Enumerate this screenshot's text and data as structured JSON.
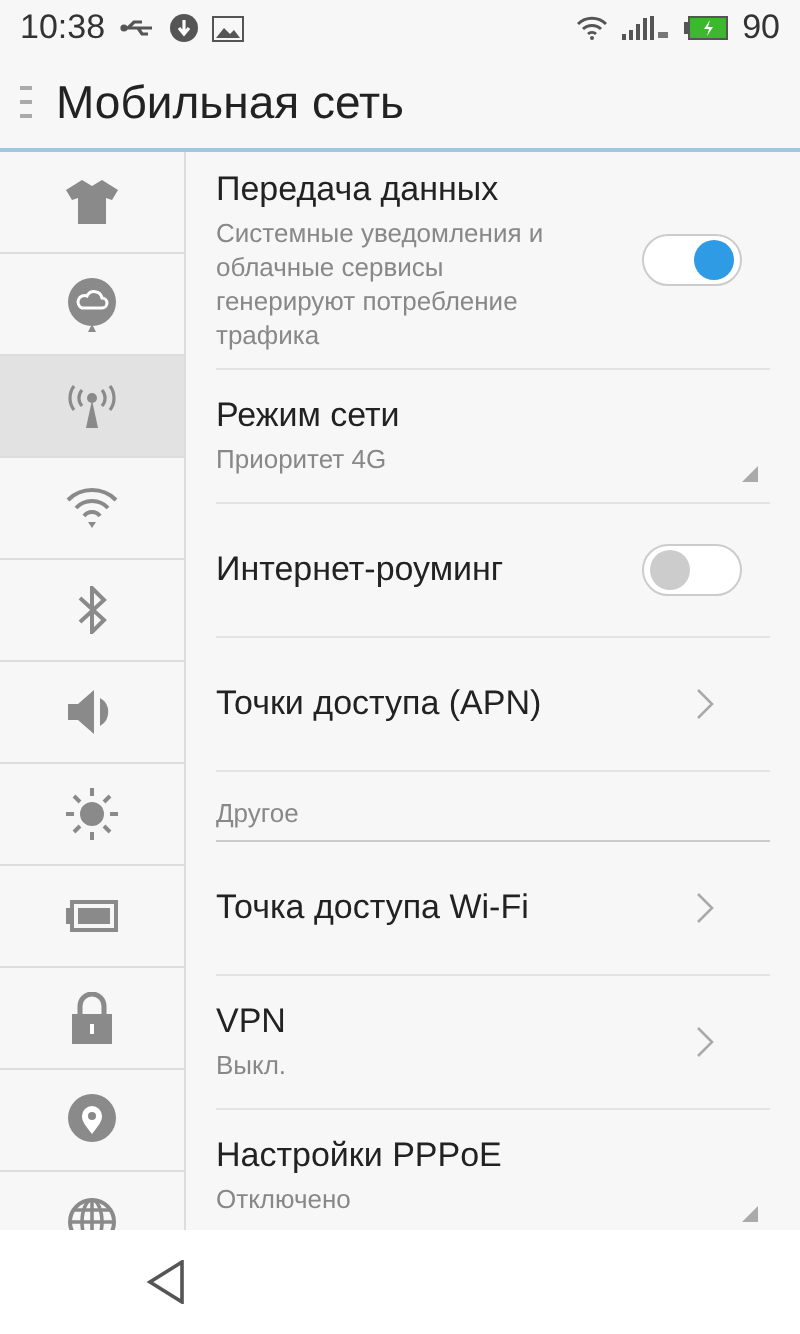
{
  "status_bar": {
    "time": "10:38",
    "battery": "90"
  },
  "title_bar": {
    "title": "Мобильная сеть"
  },
  "sidebar": {
    "items": [
      {
        "selected": false
      },
      {
        "selected": false
      },
      {
        "selected": true
      },
      {
        "selected": false
      },
      {
        "selected": false
      },
      {
        "selected": false
      },
      {
        "selected": false
      },
      {
        "selected": false
      },
      {
        "selected": false
      },
      {
        "selected": false
      },
      {
        "selected": false
      }
    ]
  },
  "settings": [
    {
      "kind": "toggle",
      "title": "Передача данных",
      "subtitle": "Системные уведомления и облачные сервисы генерируют потребление трафика",
      "on": true
    },
    {
      "kind": "dropdown",
      "title": "Режим сети",
      "subtitle": "Приоритет 4G"
    },
    {
      "kind": "toggle",
      "title": "Интернет-роуминг",
      "on": false
    },
    {
      "kind": "link",
      "title": "Точки доступа (APN)"
    },
    {
      "kind": "header",
      "title": "Другое"
    },
    {
      "kind": "link",
      "title": "Точка доступа Wi-Fi"
    },
    {
      "kind": "link",
      "title": "VPN",
      "subtitle": "Выкл."
    },
    {
      "kind": "dropdown",
      "title": "Настройки PPPoE",
      "subtitle": "Отключено"
    }
  ]
}
